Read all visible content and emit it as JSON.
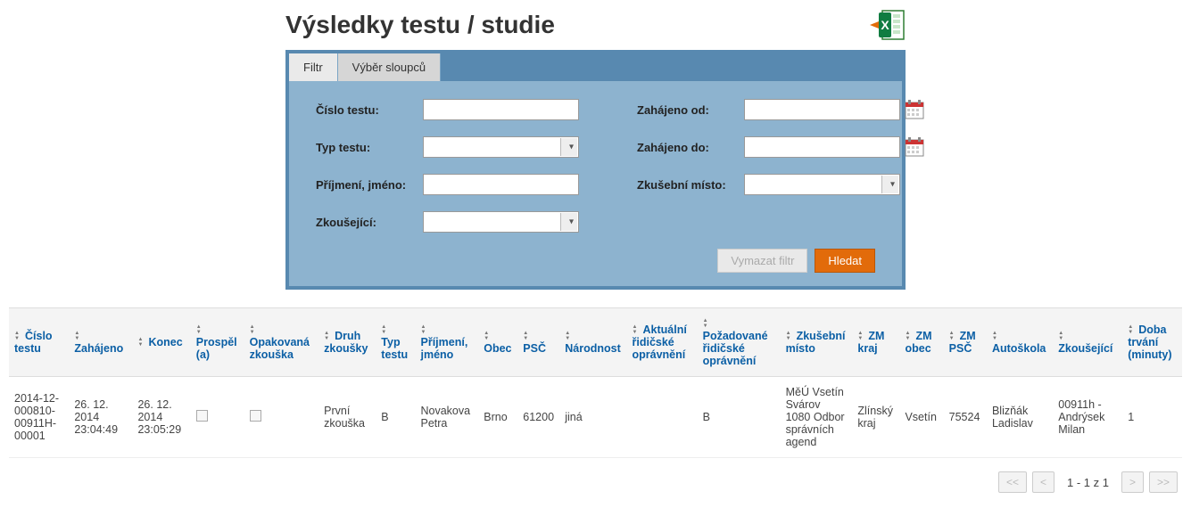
{
  "header": {
    "title": "Výsledky testu / studie"
  },
  "tabs": {
    "filter": "Filtr",
    "columns": "Výběr sloupců"
  },
  "filter": {
    "labels": {
      "test_number": "Číslo testu:",
      "test_type": "Typ testu:",
      "surname_name": "Příjmení, jméno:",
      "examiner": "Zkoušející:",
      "started_from": "Zahájeno od:",
      "started_to": "Zahájeno do:",
      "exam_location": "Zkušební místo:"
    },
    "values": {
      "test_number": "",
      "test_type": "",
      "surname_name": "",
      "examiner": "",
      "started_from": "",
      "started_to": "",
      "exam_location": ""
    },
    "buttons": {
      "clear": "Vymazat filtr",
      "search": "Hledat"
    }
  },
  "columns": [
    "Číslo testu",
    "Zahájeno",
    "Konec",
    "Prospěl (a)",
    "Opakovaná zkouška",
    "Druh zkoušky",
    "Typ testu",
    "Příjmení, jméno",
    "Obec",
    "PSČ",
    "Národnost",
    "Aktuální řidičské oprávnění",
    "Požadované řidičské oprávnění",
    "Zkušební místo",
    "ZM kraj",
    "ZM obec",
    "ZM PSČ",
    "Autoškola",
    "Zkoušející",
    "Doba trvání (minuty)"
  ],
  "rows": [
    {
      "test_number": "2014-12-000810-00911H-00001",
      "started": "26. 12. 2014 23:04:49",
      "ended": "26. 12. 2014 23:05:29",
      "passed": false,
      "repeated": false,
      "exam_kind": "První zkouška",
      "test_type": "B",
      "name": "Novakova Petra",
      "city": "Brno",
      "zip": "61200",
      "nationality": "jiná",
      "current_licence": "",
      "requested_licence": "B",
      "exam_location": "MěÚ Vsetín Svárov 1080 Odbor správních agend",
      "zm_region": "Zlínský kraj",
      "zm_city": "Vsetín",
      "zm_zip": "75524",
      "school": "Blizňák Ladislav",
      "examiner": "00911h - Andrýsek Milan",
      "duration": "1"
    }
  ],
  "pager": {
    "first": "<<",
    "prev": "<",
    "info": "1 - 1 z 1",
    "next": ">",
    "last": ">>"
  }
}
